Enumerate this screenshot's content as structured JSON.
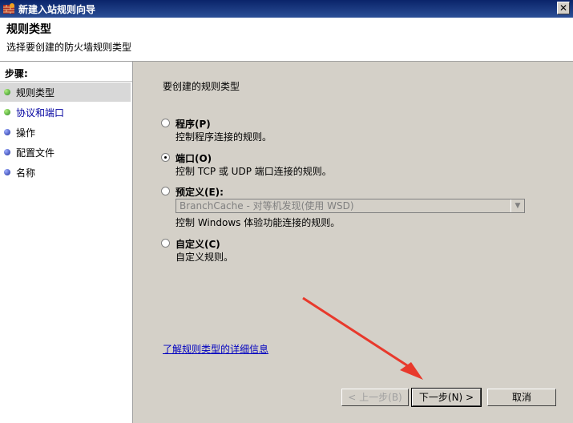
{
  "window": {
    "title": "新建入站规则向导",
    "close_label": "✕"
  },
  "header": {
    "title": "规则类型",
    "subtitle": "选择要创建的防火墙规则类型"
  },
  "steps": {
    "title": "步骤:",
    "items": [
      {
        "label": "规则类型",
        "state": "active"
      },
      {
        "label": "协议和端口",
        "state": "link"
      },
      {
        "label": "操作",
        "state": "pending"
      },
      {
        "label": "配置文件",
        "state": "pending"
      },
      {
        "label": "名称",
        "state": "pending"
      }
    ]
  },
  "main": {
    "section_title": "要创建的规则类型",
    "options": [
      {
        "label": "程序(P)",
        "description": "控制程序连接的规则。",
        "checked": false
      },
      {
        "label": "端口(O)",
        "description": "控制 TCP 或 UDP 端口连接的规则。",
        "checked": true
      },
      {
        "label": "预定义(E):",
        "select_value": "BranchCache - 对等机发现(使用 WSD)",
        "description": "控制 Windows 体验功能连接的规则。",
        "checked": false
      },
      {
        "label": "自定义(C)",
        "description": "自定义规则。",
        "checked": false
      }
    ],
    "help_link": "了解规则类型的详细信息"
  },
  "buttons": {
    "back": "< 上一步(B)",
    "next": "下一步(N) >",
    "cancel": "取消"
  },
  "colors": {
    "titlebar": "#0a246a",
    "annotation_arrow": "#e8392c"
  }
}
